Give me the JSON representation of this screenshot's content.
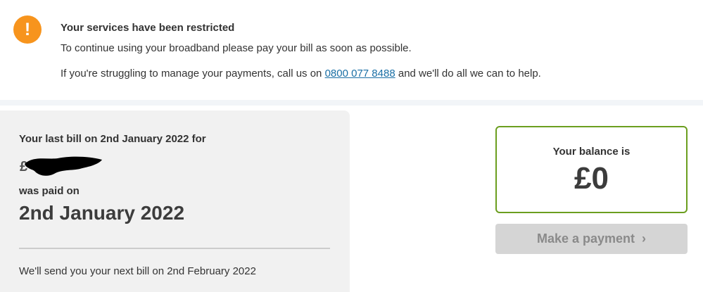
{
  "alert": {
    "icon": "exclamation-icon",
    "icon_glyph": "!",
    "icon_color": "#f7941d",
    "title": "Your services have been restricted",
    "message": "To continue using your broadband please pay your bill as soon as possible.",
    "help_prefix": "If you're struggling to manage your payments, call us on ",
    "help_phone": "0800 077 8488",
    "help_suffix": " and we'll do all we can to help."
  },
  "bill": {
    "heading": "Your last bill on 2nd January 2022 for",
    "amount_prefix": "£",
    "paid_label": "was paid on",
    "paid_date": "2nd January 2022",
    "next_bill": "We'll send you your next bill on 2nd February 2022"
  },
  "balance": {
    "label": "Your balance is",
    "value": "£0",
    "border_color": "#6b9e1f"
  },
  "payment": {
    "button_label": "Make a payment",
    "chevron": "›",
    "state": "disabled"
  }
}
